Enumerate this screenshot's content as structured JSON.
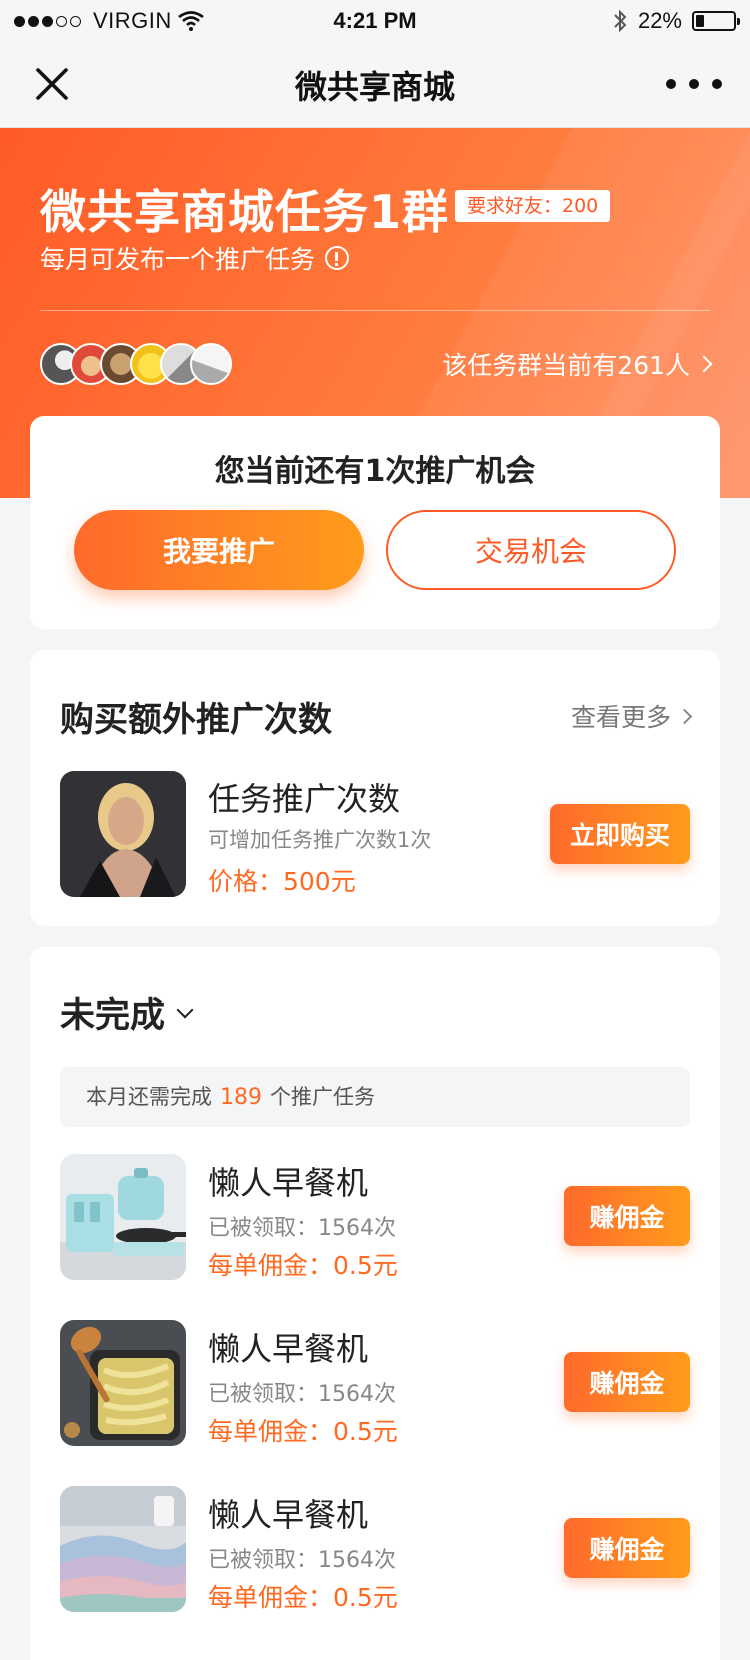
{
  "status_bar": {
    "carrier": "VIRGIN",
    "time": "4:21 PM",
    "battery": "22%",
    "battery_level": 0.22
  },
  "nav": {
    "title": "微共享商城",
    "close_icon": "close-icon",
    "more_icon": "more-icon"
  },
  "header": {
    "title": "微共享商城任务1群",
    "requirement_tag": "要求好友：200",
    "subtitle": "每月可发布一个推广任务",
    "member_count_text": "该任务群当前有261人"
  },
  "chance": {
    "title": "您当前还有1次推广机会",
    "promote_label": "我要推广",
    "trade_label": "交易机会"
  },
  "buy": {
    "title": "购买额外推广次数",
    "more_label": "查看更多",
    "item": {
      "name": "任务推广次数",
      "desc": "可增加任务推广次数1次",
      "price": "价格：500元",
      "button": "立即购买"
    }
  },
  "tasks": {
    "filter_label": "未完成",
    "note_prefix": "本月还需完成",
    "note_count": "189",
    "note_suffix": "个推广任务",
    "items": [
      {
        "name": "懒人早餐机",
        "taken": "已被领取：1564次",
        "commission": "每单佣金：0.5元",
        "button": "赚佣金"
      },
      {
        "name": "懒人早餐机",
        "taken": "已被领取：1564次",
        "commission": "每单佣金：0.5元",
        "button": "赚佣金"
      },
      {
        "name": "懒人早餐机",
        "taken": "已被领取：1564次",
        "commission": "每单佣金：0.5元",
        "button": "赚佣金"
      }
    ]
  },
  "colors": {
    "accent": "#ff5a26",
    "accent_gradient_end": "#ff9c1c",
    "price_text": "#ff6a22"
  }
}
